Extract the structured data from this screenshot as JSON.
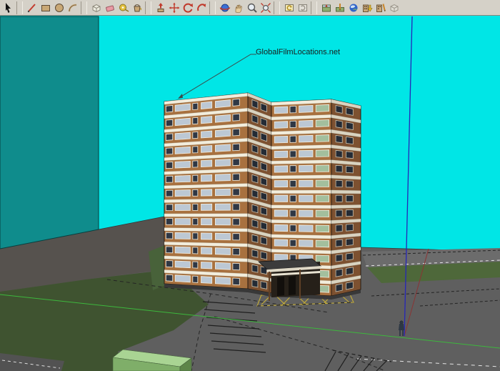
{
  "toolbar": {
    "groups": [
      {
        "name": "selection",
        "items": [
          {
            "name": "select",
            "label": "Select"
          }
        ]
      },
      {
        "name": "drawing",
        "items": [
          {
            "name": "line",
            "label": "Line"
          },
          {
            "name": "rectangle",
            "label": "Rectangle"
          },
          {
            "name": "circle",
            "label": "Circle"
          },
          {
            "name": "arc",
            "label": "Arc"
          }
        ]
      },
      {
        "name": "principal",
        "items": [
          {
            "name": "make-component",
            "label": "Make Component"
          },
          {
            "name": "eraser",
            "label": "Eraser"
          },
          {
            "name": "tape-measure",
            "label": "Tape Measure"
          },
          {
            "name": "paint-bucket",
            "label": "Paint Bucket"
          }
        ]
      },
      {
        "name": "modification",
        "items": [
          {
            "name": "push-pull",
            "label": "Push/Pull"
          },
          {
            "name": "move",
            "label": "Move"
          },
          {
            "name": "rotate",
            "label": "Rotate"
          },
          {
            "name": "offset",
            "label": "Offset"
          }
        ]
      },
      {
        "name": "camera",
        "items": [
          {
            "name": "orbit",
            "label": "Orbit"
          },
          {
            "name": "pan",
            "label": "Pan"
          },
          {
            "name": "zoom",
            "label": "Zoom"
          },
          {
            "name": "zoom-extents",
            "label": "Zoom Extents"
          }
        ]
      },
      {
        "name": "views",
        "items": [
          {
            "name": "previous-view",
            "label": "Previous View"
          },
          {
            "name": "next-view",
            "label": "Next View"
          }
        ]
      },
      {
        "name": "google",
        "items": [
          {
            "name": "get-current-view",
            "label": "Get Current View"
          },
          {
            "name": "toggle-terrain",
            "label": "Toggle Terrain"
          },
          {
            "name": "google-earth",
            "label": "Place Model in Google Earth"
          },
          {
            "name": "get-models",
            "label": "Get Models"
          },
          {
            "name": "share-model",
            "label": "Share Model"
          },
          {
            "name": "model-box",
            "label": "Component Model"
          }
        ]
      }
    ]
  },
  "viewport": {
    "annotation_text": "GlobalFilmLocations.net",
    "building": {
      "floor_count": 13
    },
    "colors": {
      "sky": "#00e6e6",
      "backdrop_wall": "#0f8c8c",
      "ground": "#5f5f5f",
      "pavement_dark": "#56524e",
      "road": "#6c6c6c",
      "grass": "#3f5330",
      "grass_light": "#4e683a",
      "grass_bank": "#48623a",
      "box_green_top": "#a9d493",
      "box_green_front": "#7fae69",
      "box_green_side": "#5d8549",
      "brick_light": "#a8713f",
      "brick_dark": "#7d5130",
      "band": "#f2eddc",
      "band_dim": "#d9d3c0",
      "glass": "#bcc8d4",
      "glass_dark": "#2f3744",
      "glass_green": "#a3bf9d",
      "axis_blue": "#2626b8",
      "axis_red": "#8a3434",
      "axis_green": "#3db83d",
      "marking_yellow": "#c6ae38",
      "edge_dark": "#242424"
    }
  }
}
